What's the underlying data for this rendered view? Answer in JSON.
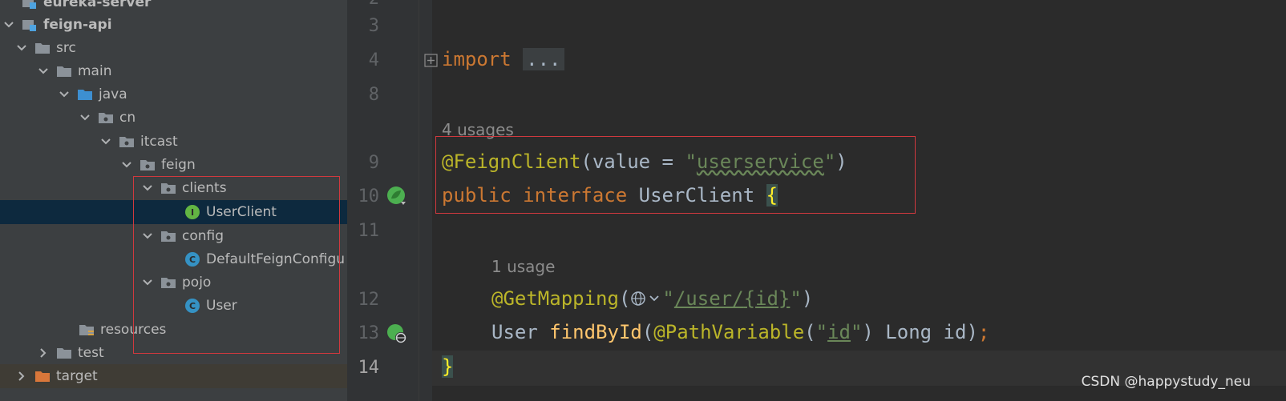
{
  "project_tree": {
    "items": [
      {
        "label": "eureka-server"
      },
      {
        "label": "feign-api"
      },
      {
        "label": "src"
      },
      {
        "label": "main"
      },
      {
        "label": "java"
      },
      {
        "label": "cn"
      },
      {
        "label": "itcast"
      },
      {
        "label": "feign"
      },
      {
        "label": "clients"
      },
      {
        "label": "UserClient",
        "badge": "I"
      },
      {
        "label": "config"
      },
      {
        "label": "DefaultFeignConfigu",
        "badge": "C"
      },
      {
        "label": "pojo"
      },
      {
        "label": "User",
        "badge": "C"
      },
      {
        "label": "resources"
      },
      {
        "label": "test"
      },
      {
        "label": "target"
      }
    ]
  },
  "editor": {
    "line_numbers": [
      "3",
      "4",
      "8",
      "9",
      "10",
      "11",
      "12",
      "13",
      "14"
    ],
    "usage_hints": [
      "4 usages",
      "1 usage"
    ],
    "tokens": {
      "import_kw": "import",
      "import_fold": "...",
      "feign_annotation": "@FeignClient",
      "feign_args_open": "(value = ",
      "feign_q1": "\"",
      "feign_value": "userservice",
      "feign_q2": "\"",
      "feign_args_close": ")",
      "public_kw": "public",
      "interface_kw": "interface",
      "class_name": " UserClient ",
      "open_brace": "{",
      "get_annotation": "@GetMapping",
      "get_paren_open": "(",
      "get_q1": "\"",
      "get_path_a": "/user/",
      "get_path_b": "{id}",
      "get_q2": "\"",
      "get_paren_close": ")",
      "return_type": "User ",
      "method_name": "findById",
      "param_open": "(",
      "param_annotation": "@PathVariable",
      "param_paren_open": "(",
      "param_q1": "\"",
      "param_value": "id",
      "param_q2": "\"",
      "param_rest": ") Long id)",
      "semicolon": ";",
      "close_brace": "}"
    }
  },
  "watermark": "CSDN @happystudy_neu",
  "colors": {
    "keyword": "#cc7832",
    "annotation": "#bbb529",
    "string": "#6a8759",
    "method": "#ffc66d",
    "highlight_box": "#d0393e"
  }
}
